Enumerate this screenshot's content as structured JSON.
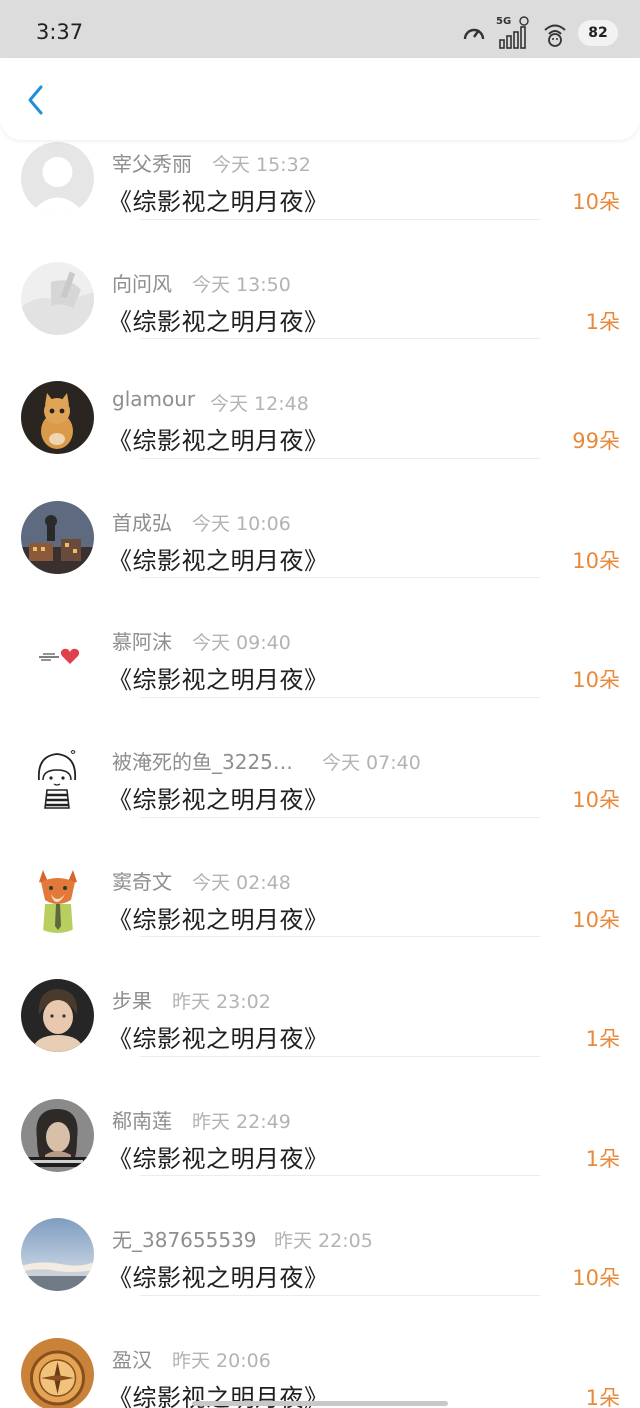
{
  "status_bar": {
    "time": "3:37",
    "network_label": "5G",
    "battery": "82"
  },
  "colors": {
    "accent": "#1e90d8",
    "amount": "#e8893a"
  },
  "records": [
    {
      "name": "宰父秀丽",
      "time": "今天 15:32",
      "title": "《综影视之明月夜》",
      "amount": "10朵",
      "avatar": "default-avatar-icon"
    },
    {
      "name": "向问风",
      "time": "今天 13:50",
      "title": "《综影视之明月夜》",
      "amount": "1朵",
      "avatar": "portrait-photo-icon"
    },
    {
      "name": "glamour",
      "time": "今天 12:48",
      "title": "《综影视之明月夜》",
      "amount": "99朵",
      "avatar": "cat-icon"
    },
    {
      "name": "首成弘",
      "time": "今天 10:06",
      "title": "《综影视之明月夜》",
      "amount": "10朵",
      "avatar": "night-city-icon"
    },
    {
      "name": "慕阿沫",
      "time": "今天 09:40",
      "title": "《综影视之明月夜》",
      "amount": "10朵",
      "avatar": "heart-icon"
    },
    {
      "name": "被淹死的鱼_3225…",
      "time": "今天 07:40",
      "title": "《综影视之明月夜》",
      "amount": "10朵",
      "avatar": "cartoon-girl-icon"
    },
    {
      "name": "窦奇文",
      "time": "今天 02:48",
      "title": "《综影视之明月夜》",
      "amount": "10朵",
      "avatar": "fox-icon"
    },
    {
      "name": "步果",
      "time": "昨天 23:02",
      "title": "《综影视之明月夜》",
      "amount": "1朵",
      "avatar": "portrait-photo-icon"
    },
    {
      "name": "郗南莲",
      "time": "昨天 22:49",
      "title": "《综影视之明月夜》",
      "amount": "1朵",
      "avatar": "portrait-photo-icon"
    },
    {
      "name": "无_387655539",
      "time": "昨天 22:05",
      "title": "《综影视之明月夜》",
      "amount": "10朵",
      "avatar": "sky-icon"
    },
    {
      "name": "盈汉",
      "time": "昨天 20:06",
      "title": "《综影视之明月夜》",
      "amount": "1朵",
      "avatar": "compass-icon"
    }
  ]
}
